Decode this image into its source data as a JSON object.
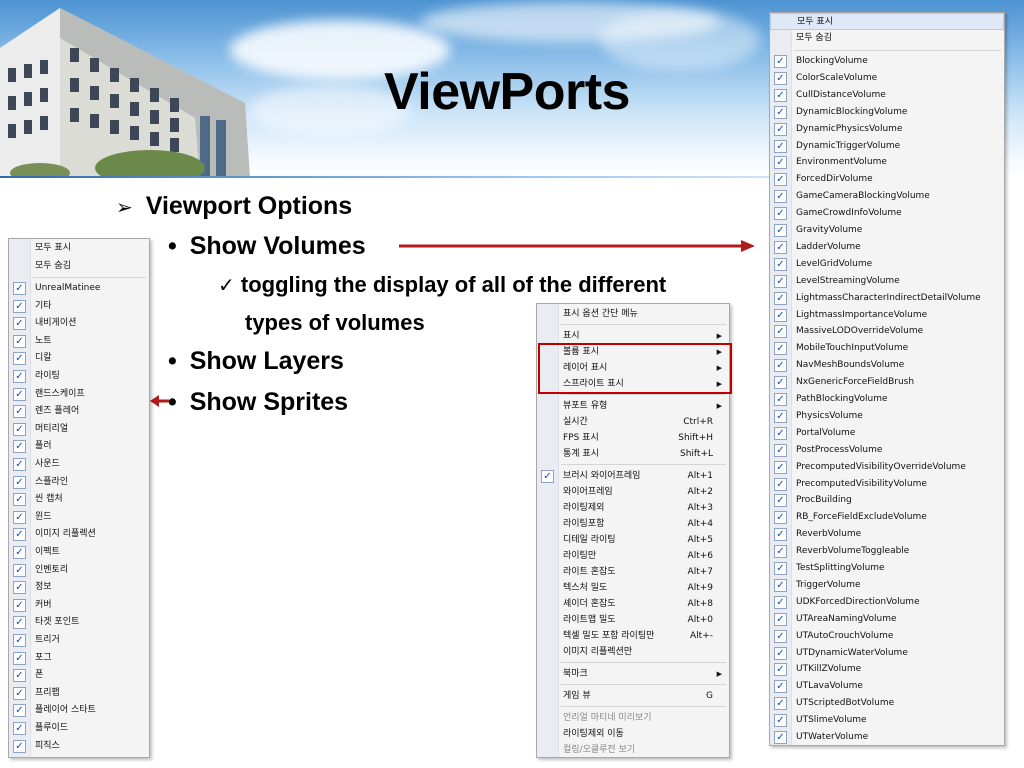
{
  "slide": {
    "title": "ViewPorts",
    "bullets": {
      "viewport_options": "Viewport Options",
      "show_volumes": "Show Volumes",
      "toggling_line1": "toggling the display of all of the different",
      "toggling_line2": "types of volumes",
      "show_layers": "Show Layers",
      "show_sprites": "Show Sprites"
    },
    "glyphs": {
      "arrow_bullet": "➢",
      "dot_bullet": "•",
      "check_bullet": "✓"
    },
    "colors": {
      "arrow_red": "#b01c1c",
      "highlight_box": "#c00000"
    }
  },
  "sprites_menu": {
    "header": [
      "모두 표시",
      "모두 숨김"
    ],
    "items": [
      "UnrealMatinee",
      "기타",
      "내비게이션",
      "노트",
      "디칼",
      "라이팅",
      "랜드스케이프",
      "렌즈 플레어",
      "머티리얼",
      "플러",
      "사운드",
      "스플라인",
      "씬 캡처",
      "윈드",
      "이미지 리플렉션",
      "이펙트",
      "인벤토리",
      "정보",
      "커버",
      "타겟 포인트",
      "트리거",
      "포그",
      "폰",
      "프리팹",
      "플레이어 스타트",
      "플루이드",
      "피직스"
    ]
  },
  "context_menu": {
    "items": [
      {
        "label": "표시 옵션 간단 메뉴",
        "shortcut": "",
        "submenu": false,
        "checked": false,
        "dim": false
      },
      {
        "label": "표시",
        "shortcut": "",
        "submenu": true,
        "checked": false,
        "dim": false
      },
      {
        "label": "볼륨 표시",
        "shortcut": "",
        "submenu": true,
        "checked": false,
        "dim": false
      },
      {
        "label": "레이어 표시",
        "shortcut": "",
        "submenu": true,
        "checked": false,
        "dim": false
      },
      {
        "label": "스프라이트 표시",
        "shortcut": "",
        "submenu": true,
        "checked": false,
        "dim": false
      },
      {
        "label": "뷰포트 유형",
        "shortcut": "",
        "submenu": true,
        "checked": false,
        "dim": false
      },
      {
        "label": "실시간",
        "shortcut": "Ctrl+R",
        "submenu": false,
        "checked": false,
        "dim": false
      },
      {
        "label": "FPS 표시",
        "shortcut": "Shift+H",
        "submenu": false,
        "checked": false,
        "dim": false
      },
      {
        "label": "통계 표시",
        "shortcut": "Shift+L",
        "submenu": false,
        "checked": false,
        "dim": false
      },
      {
        "label": "브러시 와이어프레임",
        "shortcut": "Alt+1",
        "submenu": false,
        "checked": true,
        "dim": false
      },
      {
        "label": "와이어프레임",
        "shortcut": "Alt+2",
        "submenu": false,
        "checked": false,
        "dim": false
      },
      {
        "label": "라이팅제외",
        "shortcut": "Alt+3",
        "submenu": false,
        "checked": false,
        "dim": false
      },
      {
        "label": "라이팅포함",
        "shortcut": "Alt+4",
        "submenu": false,
        "checked": false,
        "dim": false
      },
      {
        "label": "디테일 라이팅",
        "shortcut": "Alt+5",
        "submenu": false,
        "checked": false,
        "dim": false
      },
      {
        "label": "라이팅만",
        "shortcut": "Alt+6",
        "submenu": false,
        "checked": false,
        "dim": false
      },
      {
        "label": "라이트 혼잡도",
        "shortcut": "Alt+7",
        "submenu": false,
        "checked": false,
        "dim": false
      },
      {
        "label": "텍스처 밀도",
        "shortcut": "Alt+9",
        "submenu": false,
        "checked": false,
        "dim": false
      },
      {
        "label": "셰이더 혼잡도",
        "shortcut": "Alt+8",
        "submenu": false,
        "checked": false,
        "dim": false
      },
      {
        "label": "라이트맵 밀도",
        "shortcut": "Alt+0",
        "submenu": false,
        "checked": false,
        "dim": false
      },
      {
        "label": "텍셀 밀도 포함 라이팅만",
        "shortcut": "Alt+-",
        "submenu": false,
        "checked": false,
        "dim": false
      },
      {
        "label": "이미지 리플렉션만",
        "shortcut": "",
        "submenu": false,
        "checked": false,
        "dim": false
      },
      {
        "label": "북마크",
        "shortcut": "",
        "submenu": true,
        "checked": false,
        "dim": false
      },
      {
        "label": "게임 뷰",
        "shortcut": "G",
        "submenu": false,
        "checked": false,
        "dim": false
      },
      {
        "label": "언리얼 마티네 미리보기",
        "shortcut": "",
        "submenu": false,
        "checked": false,
        "dim": true
      },
      {
        "label": "라이팅제외 이동",
        "shortcut": "",
        "submenu": false,
        "checked": false,
        "dim": false
      },
      {
        "label": "컬링/오클루전 보기",
        "shortcut": "",
        "submenu": false,
        "checked": false,
        "dim": true
      }
    ]
  },
  "volumes_menu": {
    "header": [
      "모두 표시",
      "모두 숨김"
    ],
    "items": [
      "BlockingVolume",
      "ColorScaleVolume",
      "CullDistanceVolume",
      "DynamicBlockingVolume",
      "DynamicPhysicsVolume",
      "DynamicTriggerVolume",
      "EnvironmentVolume",
      "ForcedDirVolume",
      "GameCameraBlockingVolume",
      "GameCrowdInfoVolume",
      "GravityVolume",
      "LadderVolume",
      "LevelGridVolume",
      "LevelStreamingVolume",
      "LightmassCharacterIndirectDetailVolume",
      "LightmassImportanceVolume",
      "MassiveLODOverrideVolume",
      "MobileTouchInputVolume",
      "NavMeshBoundsVolume",
      "NxGenericForceFieldBrush",
      "PathBlockingVolume",
      "PhysicsVolume",
      "PortalVolume",
      "PostProcessVolume",
      "PrecomputedVisibilityOverrideVolume",
      "PrecomputedVisibilityVolume",
      "ProcBuilding",
      "RB_ForceFieldExcludeVolume",
      "ReverbVolume",
      "ReverbVolumeToggleable",
      "TestSplittingVolume",
      "TriggerVolume",
      "UDKForcedDirectionVolume",
      "UTAreaNamingVolume",
      "UTAutoCrouchVolume",
      "UTDynamicWaterVolume",
      "UTKillZVolume",
      "UTLavaVolume",
      "UTScriptedBotVolume",
      "UTSlimeVolume",
      "UTWaterVolume"
    ]
  }
}
